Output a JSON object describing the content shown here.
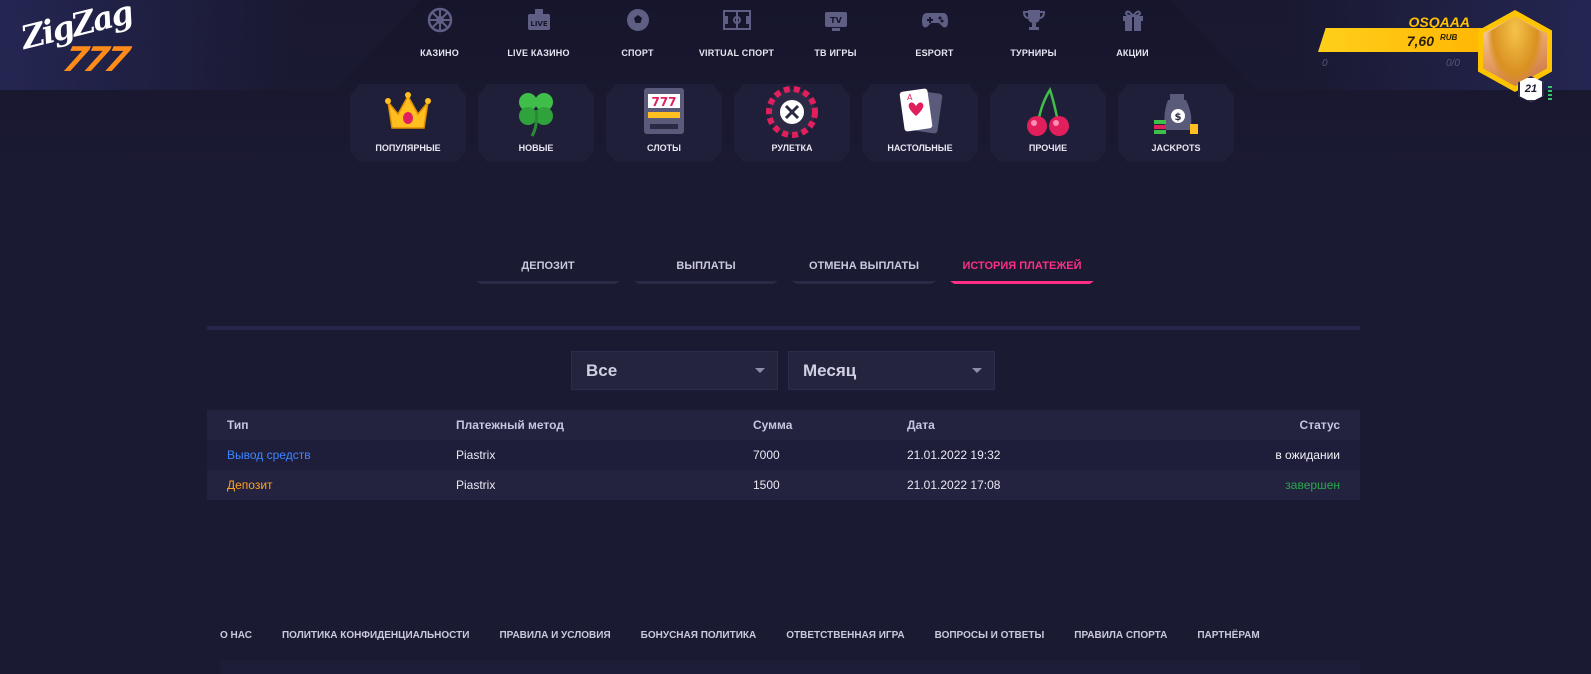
{
  "brand": {
    "logo_top": "ZigZag",
    "logo_num": "777"
  },
  "topnav": [
    {
      "label": "КАЗИНО",
      "icon": "roulette-wheel-icon"
    },
    {
      "label": "LIVE КАЗИНО",
      "icon": "live-tv-icon"
    },
    {
      "label": "СПОРТ",
      "icon": "soccer-ball-icon"
    },
    {
      "label": "VIRTUAL СПОРТ",
      "icon": "virtual-field-icon"
    },
    {
      "label": "ТВ ИГРЫ",
      "icon": "tv-icon"
    },
    {
      "label": "ESPORT",
      "icon": "gamepad-icon"
    },
    {
      "label": "ТУРНИРЫ",
      "icon": "trophy-icon"
    },
    {
      "label": "АКЦИИ",
      "icon": "gift-icon"
    }
  ],
  "categories": [
    {
      "label": "ПОПУЛЯРНЫЕ",
      "icon": "crown-icon"
    },
    {
      "label": "НОВЫЕ",
      "icon": "clover-icon"
    },
    {
      "label": "СЛОТЫ",
      "icon": "slot-machine-icon"
    },
    {
      "label": "РУЛЕТКА",
      "icon": "roulette-icon"
    },
    {
      "label": "НАСТОЛЬНЫЕ",
      "icon": "playing-card-icon"
    },
    {
      "label": "ПРОЧИЕ",
      "icon": "cherries-icon"
    },
    {
      "label": "JACKPOTS",
      "icon": "money-bag-icon"
    }
  ],
  "slot_text": "777",
  "card_letter": "A",
  "money_symbol": "$",
  "user": {
    "name": "OSQAAA",
    "balance": "7,60",
    "currency": "RUB",
    "sub_left": "0",
    "sub_right": "0/0",
    "level": "21"
  },
  "payment_tabs": [
    {
      "label": "ДЕПОЗИТ",
      "active": false
    },
    {
      "label": "ВЫПЛАТЫ",
      "active": false
    },
    {
      "label": "ОТМЕНА ВЫПЛАТЫ",
      "active": false
    },
    {
      "label": "ИСТОРИЯ ПЛАТЕЖЕЙ",
      "active": true
    }
  ],
  "filters": {
    "type_value": "Все",
    "period_value": "Месяц"
  },
  "table": {
    "headers": [
      "Тип",
      "Платежный метод",
      "Сумма",
      "Дата",
      "Статус"
    ],
    "rows": [
      {
        "type": "Вывод средств",
        "method": "Piastrix",
        "amount": "7000",
        "date": "21.01.2022 19:32",
        "status": "в ожидании"
      },
      {
        "type": "Депозит",
        "method": "Piastrix",
        "amount": "1500",
        "date": "21.01.2022 17:08",
        "status": "завершен"
      }
    ]
  },
  "footer_links": [
    "О НАС",
    "ПОЛИТИКА КОНФИДЕНЦИАЛЬНОСТИ",
    "ПРАВИЛА И УСЛОВИЯ",
    "БОНУСНАЯ ПОЛИТИКА",
    "ОТВЕТСТВЕННАЯ ИГРА",
    "ВОПРОСЫ И ОТВЕТЫ",
    "ПРАВИЛА СПОРТА",
    "ПАРТНЁРАМ"
  ],
  "colors": {
    "background": "#1b1a33",
    "accent_pink": "#ff2e85",
    "gold": "#ffc400",
    "link_blue": "#3d86ff",
    "deposit_orange": "#ffa21f",
    "status_green": "#2aa84c"
  }
}
